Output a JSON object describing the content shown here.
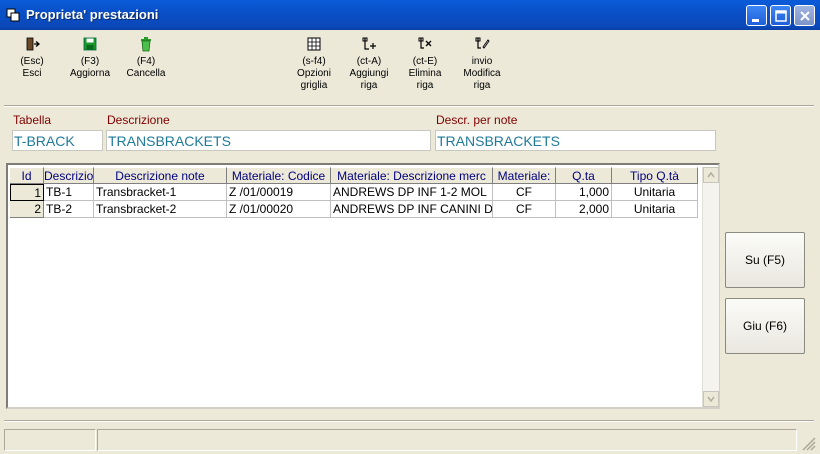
{
  "window": {
    "title": "Proprieta' prestazioni"
  },
  "toolbar": [
    {
      "key": "(Esc)",
      "label": "Esci",
      "icon": "exit-door-icon"
    },
    {
      "key": "(F3)",
      "label": "Aggiorna",
      "icon": "save-floppy-icon"
    },
    {
      "key": "(F4)",
      "label": "Cancella",
      "icon": "trash-can-icon"
    },
    {
      "key": "(s-f4)",
      "label1": "Opzioni",
      "label2": "griglia",
      "icon": "grid-options-icon"
    },
    {
      "key": "(ct-A)",
      "label1": "Aggiungi",
      "label2": "riga",
      "icon": "add-row-icon"
    },
    {
      "key": "(ct-E)",
      "label1": "Elimina",
      "label2": "riga",
      "icon": "delete-row-icon"
    },
    {
      "key": "invio",
      "label1": "Modifica",
      "label2": "riga",
      "icon": "edit-row-icon"
    }
  ],
  "fields": {
    "tabella": {
      "label": "Tabella",
      "value": "T-BRACK"
    },
    "descrizione": {
      "label": "Descrizione",
      "value": "TRANSBRACKETS"
    },
    "descr_note": {
      "label": "Descr. per note",
      "value": "TRANSBRACKETS"
    }
  },
  "grid": {
    "columns": [
      "Id",
      "Descrizio",
      "Descrizione note",
      "Materiale: Codice",
      "Materiale: Descrizione merc",
      "Materiale:",
      "Q.ta",
      "Tipo Q.tà"
    ],
    "rows": [
      [
        "1",
        "TB-1",
        "Transbracket-1",
        "Z /01/00019",
        "ANDREWS DP INF 1-2 MOL",
        "CF",
        "1,000",
        "Unitaria"
      ],
      [
        "2",
        "TB-2",
        "Transbracket-2",
        "Z /01/00020",
        "ANDREWS DP INF CANINI D",
        "CF",
        "2,000",
        "Unitaria"
      ]
    ]
  },
  "side_buttons": {
    "up": "Su (F5)",
    "down": "Giu (F6)"
  },
  "colors": {
    "titlebar": "#0a5bd9",
    "label": "#800000",
    "field_text": "#1f7a9a",
    "header_text": "#000080"
  }
}
